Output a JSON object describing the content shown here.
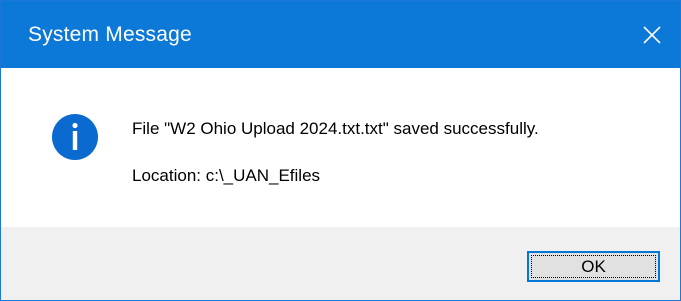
{
  "window": {
    "title": "System Message",
    "close_icon": "close-icon"
  },
  "message": {
    "icon": "info-icon",
    "line1": "File \"W2 Ohio Upload 2024.txt.txt\" saved successfully.",
    "line2": "Location: c:\\_UAN_Efiles"
  },
  "buttons": {
    "ok_label": "OK"
  },
  "colors": {
    "titlebar": "#0c78d7",
    "info_icon": "#0a6ad0",
    "footer": "#f0f0f0",
    "button_border": "#0078d7"
  }
}
